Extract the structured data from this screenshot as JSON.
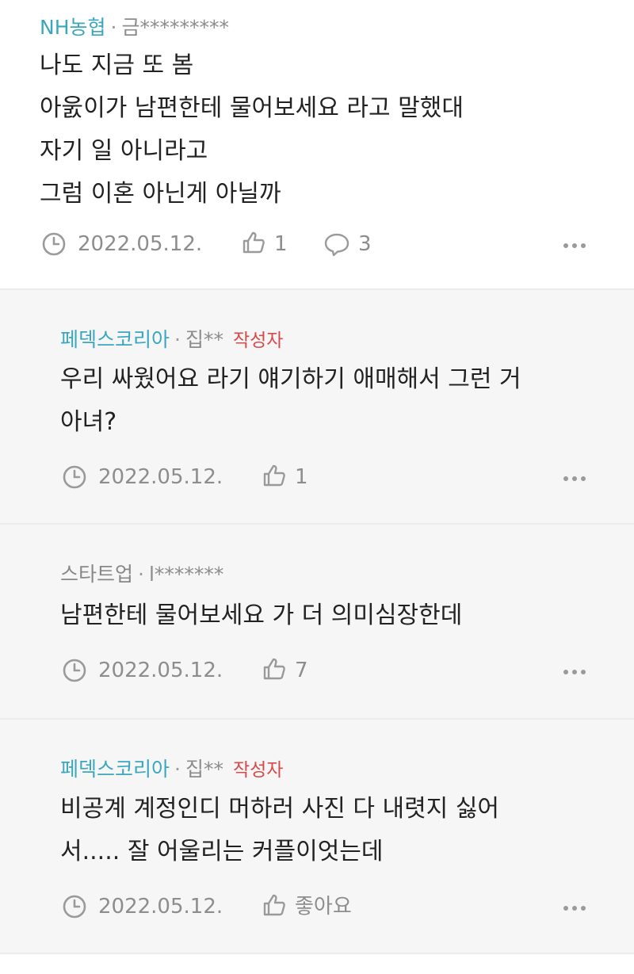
{
  "comments": [
    {
      "author": "NH농협",
      "separator": "·",
      "masked_id": "금*********",
      "badge": "",
      "body": "나도 지금 또 봄\n아욼이가 남편한테 물어보세요 라고 말했대\n자기 일 아니라고\n그럼 이혼 아닌게 아닐까",
      "date": "2022.05.12.",
      "likes": "1",
      "replies": "3"
    },
    {
      "author": "페덱스코리아",
      "separator": "·",
      "masked_id": "집**",
      "badge": "작성자",
      "body": "우리 싸웠어요 라기 얘기하기 애매해서 그런 거\n아녀?",
      "date": "2022.05.12.",
      "likes": "1"
    },
    {
      "author": "스타트업",
      "separator": "·",
      "masked_id": "l*******",
      "badge": "",
      "body": "남편한테 물어보세요 가 더 의미심장한데",
      "date": "2022.05.12.",
      "likes": "7"
    },
    {
      "author": "페덱스코리아",
      "separator": "·",
      "masked_id": "집**",
      "badge": "작성자",
      "body": "비공계 계정인디 머하러 사진 다 내렷지 싫어\n서..... 잘 어울리는 커플이엇는데",
      "date": "2022.05.12.",
      "likes": "좋아요"
    }
  ],
  "colors": {
    "author_accent": "#3aa7bf",
    "badge": "#d84a4a",
    "reply_background": "#f6f6f6",
    "meta_text": "#8d8d8d"
  },
  "icons": [
    "clock-icon",
    "thumbs-up-icon",
    "speech-bubble-icon",
    "more-options-icon"
  ]
}
